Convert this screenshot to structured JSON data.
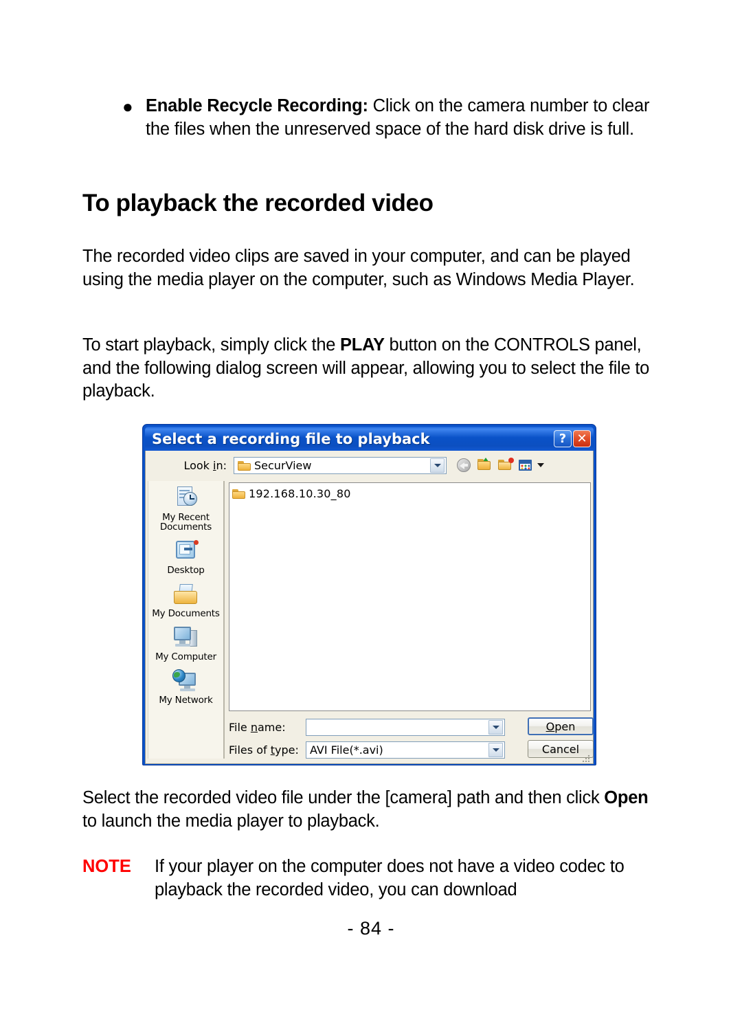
{
  "document": {
    "bullet": {
      "marker": "●",
      "bold_lead": "Enable Recycle Recording:",
      "rest": " Click on the camera number to clear the files when the unreserved space of the hard disk drive is full."
    },
    "section_title": "To playback the recorded video",
    "paragraph_1": "The recorded video clips are saved in your computer, and can be played using the media player on the computer, such as Windows Media Player.",
    "paragraph_2": {
      "part_1": "To start playback, simply click the ",
      "bold_1": "PLAY",
      "part_2": " button on the CONTROLS panel, and the following dialog screen will appear, allowing you to select the file to playback."
    },
    "paragraph_3": {
      "part_1": "Select the recorded video file under the [camera] path and then click ",
      "bold_1": "Open",
      "part_2": " to launch the media player to playback."
    },
    "note": {
      "label": "NOTE",
      "label_color": "#ff0000",
      "text": "If your player on the computer does not have a video codec to playback the recorded video, you can download"
    },
    "page_number": "- 84 -"
  },
  "dialog": {
    "title": "Select a recording file to playback",
    "titlebar_color": "#0a52c8",
    "help_button": "?",
    "close_button": "✕",
    "lookin": {
      "label_pre": "Look ",
      "label_accel": "i",
      "label_post": "n:",
      "value": "SecurView"
    },
    "toolbar": [
      {
        "name": "back-icon",
        "tooltip": "Back"
      },
      {
        "name": "up-one-level-icon",
        "tooltip": "Up One Level"
      },
      {
        "name": "new-folder-icon",
        "tooltip": "Create New Folder"
      },
      {
        "name": "views-icon",
        "tooltip": "Views"
      }
    ],
    "places": [
      {
        "id": "my-recent-documents",
        "label": "My Recent Documents"
      },
      {
        "id": "desktop",
        "label": "Desktop"
      },
      {
        "id": "my-documents",
        "label": "My Documents"
      },
      {
        "id": "my-computer",
        "label": "My Computer"
      },
      {
        "id": "my-network",
        "label": "My Network"
      }
    ],
    "files": [
      {
        "name": "192.168.10.30_80",
        "type": "folder"
      }
    ],
    "file_name": {
      "label_pre": "File ",
      "label_accel": "n",
      "label_post": "ame:",
      "value": "",
      "placeholder": ""
    },
    "files_of_type": {
      "label_pre": "Files of ",
      "label_accel": "t",
      "label_post": "ype:",
      "value": "AVI File(*.avi)",
      "options": [
        "AVI File(*.avi)"
      ]
    },
    "buttons": {
      "open_pre": "",
      "open_accel": "O",
      "open_post": "pen",
      "cancel": "Cancel"
    }
  }
}
